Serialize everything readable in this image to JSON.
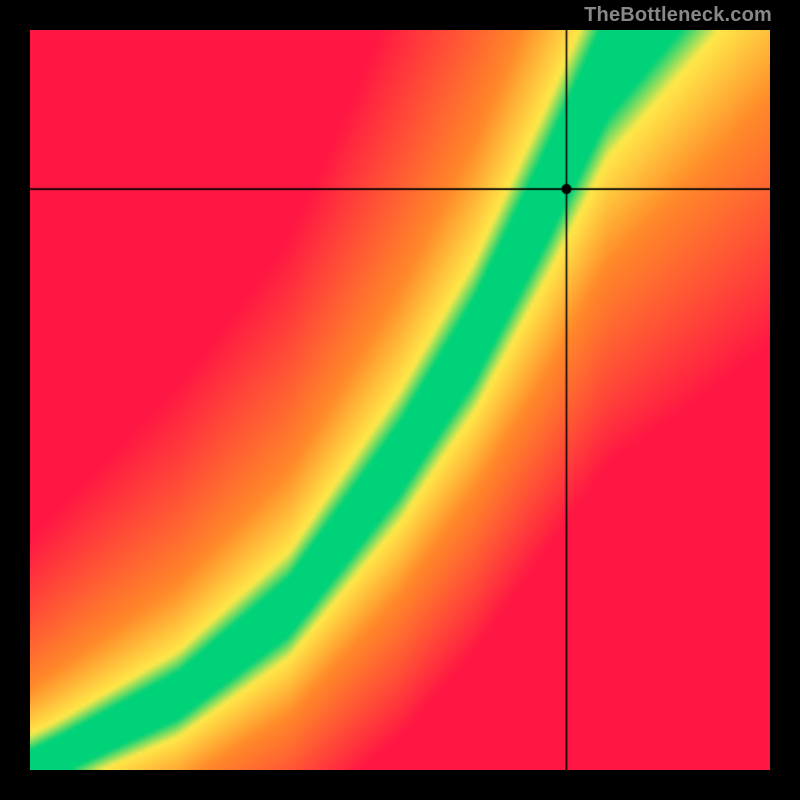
{
  "watermark": "TheBottleneck.com",
  "chart_data": {
    "type": "heatmap",
    "title": "",
    "xlabel": "",
    "ylabel": "",
    "xlim": [
      0,
      1
    ],
    "ylim": [
      0,
      1
    ],
    "grid_size": 200,
    "ridge": {
      "description": "Green optimal-ratio band along a monotone curve from bottom-left toward upper area; crosshair marks a point on/near the band.",
      "control_points_xy": [
        [
          0.0,
          0.0
        ],
        [
          0.2,
          0.1
        ],
        [
          0.35,
          0.22
        ],
        [
          0.5,
          0.42
        ],
        [
          0.6,
          0.58
        ],
        [
          0.7,
          0.78
        ],
        [
          0.78,
          0.95
        ],
        [
          0.82,
          1.0
        ]
      ],
      "band_halfwidth": 0.055
    },
    "crosshair": {
      "x": 0.725,
      "y": 0.785
    },
    "colors": {
      "green": "#00d27a",
      "yellow": "#ffe94a",
      "orange": "#ff8a2a",
      "red": "#ff1744"
    }
  }
}
